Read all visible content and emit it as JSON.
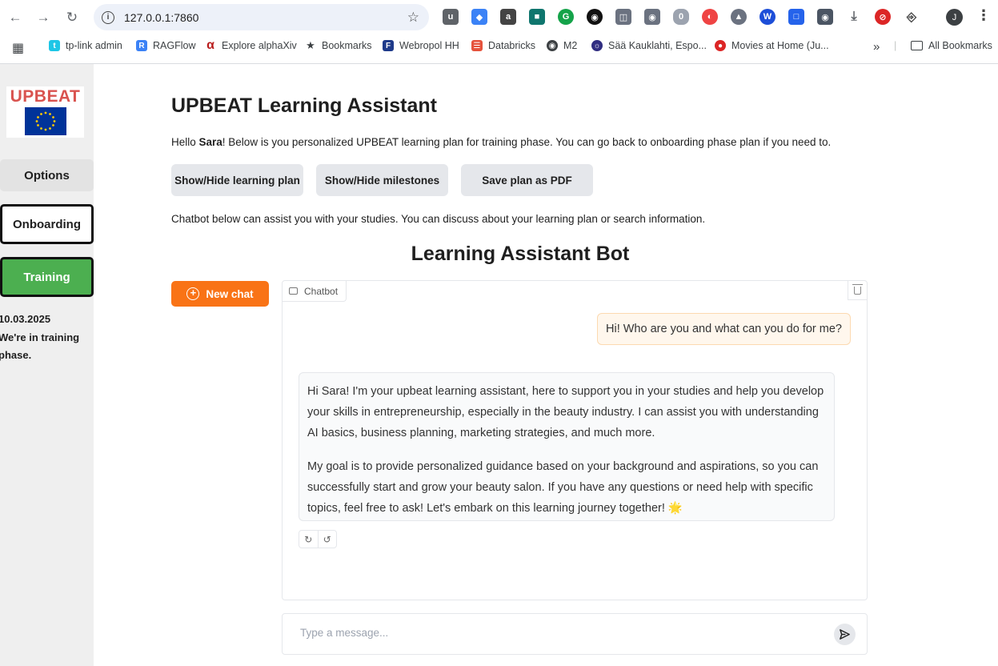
{
  "browser": {
    "url": "127.0.0.1:7860",
    "profile_initial": "J",
    "bookmarks": [
      {
        "label": "tp-link admin",
        "color": "#1ec6e6"
      },
      {
        "label": "RAGFlow",
        "color": "#3b82f6"
      },
      {
        "label": "Explore alphaXiv",
        "color": "#b91c1c"
      },
      {
        "label": "Bookmarks",
        "color": "#3c4043"
      },
      {
        "label": "Webropol HH",
        "color": "#1e3a8a"
      },
      {
        "label": "Databricks",
        "color": "#e5533d"
      },
      {
        "label": "M2",
        "color": "#3c4043"
      },
      {
        "label": "Sää Kauklahti, Espo...",
        "color": "#312e81"
      },
      {
        "label": "Movies at Home (Ju...",
        "color": "#dc2626"
      }
    ],
    "all_bookmarks_label": "All Bookmarks",
    "more_label": "»"
  },
  "sidebar": {
    "logo_text": "UPBEAT",
    "options_label": "Options",
    "onboarding_label": "Onboarding",
    "training_label": "Training",
    "status_text": "10.03.2025\nWe're in training\nphase.",
    "training_color": "#4caf50"
  },
  "main": {
    "title": "UPBEAT Learning Assistant",
    "greeting_prefix": "Hello ",
    "user_name": "Sara",
    "greeting_suffix": "! Below is you personalized UPBEAT learning plan for training phase. You can go back to onboarding phase plan if you need to.",
    "buttons": {
      "toggle_plan": "Show/Hide learning plan",
      "toggle_milestones": "Show/Hide milestones",
      "save_pdf": "Save plan as PDF"
    },
    "chat_intro": "Chatbot below can assist you with your studies. You can discuss about your learning plan or search information.",
    "bot_heading": "Learning Assistant Bot"
  },
  "chat": {
    "new_chat_label": "New chat",
    "new_chat_color": "#f97316",
    "tag_label": "Chatbot",
    "messages": [
      {
        "role": "user",
        "text": "Hi! Who are you and what can you do for me?"
      },
      {
        "role": "bot",
        "paragraphs": [
          "Hi Sara! I'm your upbeat learning assistant, here to support you in your studies and help you develop your skills in entrepreneurship, especially in the beauty industry. I can assist you with understanding AI basics, business planning, marketing strategies, and much more.",
          "My goal is to provide personalized guidance based on your background and aspirations, so you can successfully start and grow your beauty salon. If you have any questions or need help with specific topics, feel free to ask! Let's embark on this learning journey together! 🌟"
        ]
      }
    ],
    "input_placeholder": "Type a message..."
  }
}
